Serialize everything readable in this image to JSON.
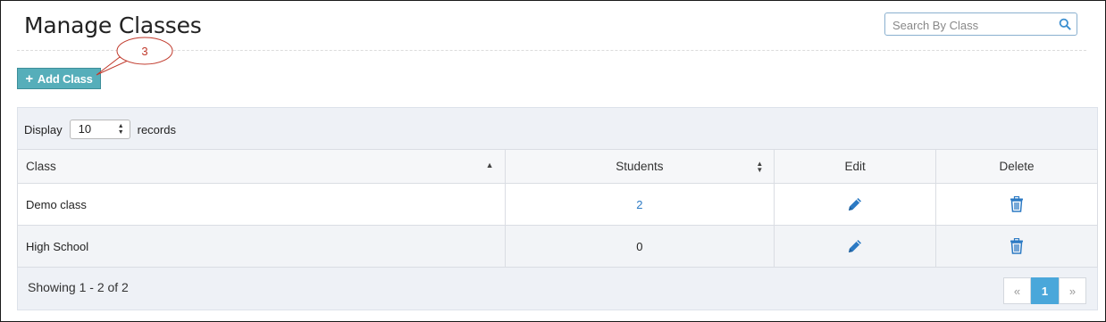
{
  "page": {
    "title": "Manage Classes"
  },
  "search": {
    "placeholder": "Search By Class",
    "value": ""
  },
  "toolbar": {
    "add_label": "Add Class"
  },
  "callout": {
    "number": "3"
  },
  "length_control": {
    "prefix": "Display",
    "value": "10",
    "suffix": "records"
  },
  "table": {
    "columns": [
      "Class",
      "Students",
      "Edit",
      "Delete"
    ],
    "rows": [
      {
        "class": "Demo class",
        "students": "2"
      },
      {
        "class": "High School",
        "students": "0"
      }
    ]
  },
  "footer": {
    "info": "Showing 1 - 2 of 2"
  },
  "pagination": {
    "prev": "«",
    "current": "1",
    "next": "»"
  },
  "colors": {
    "accent": "#56aeba",
    "link": "#2c7ac4",
    "active_page": "#4aa7da"
  },
  "icons": {
    "edit": "pencil-icon",
    "delete": "trash-icon",
    "search": "search-icon"
  }
}
